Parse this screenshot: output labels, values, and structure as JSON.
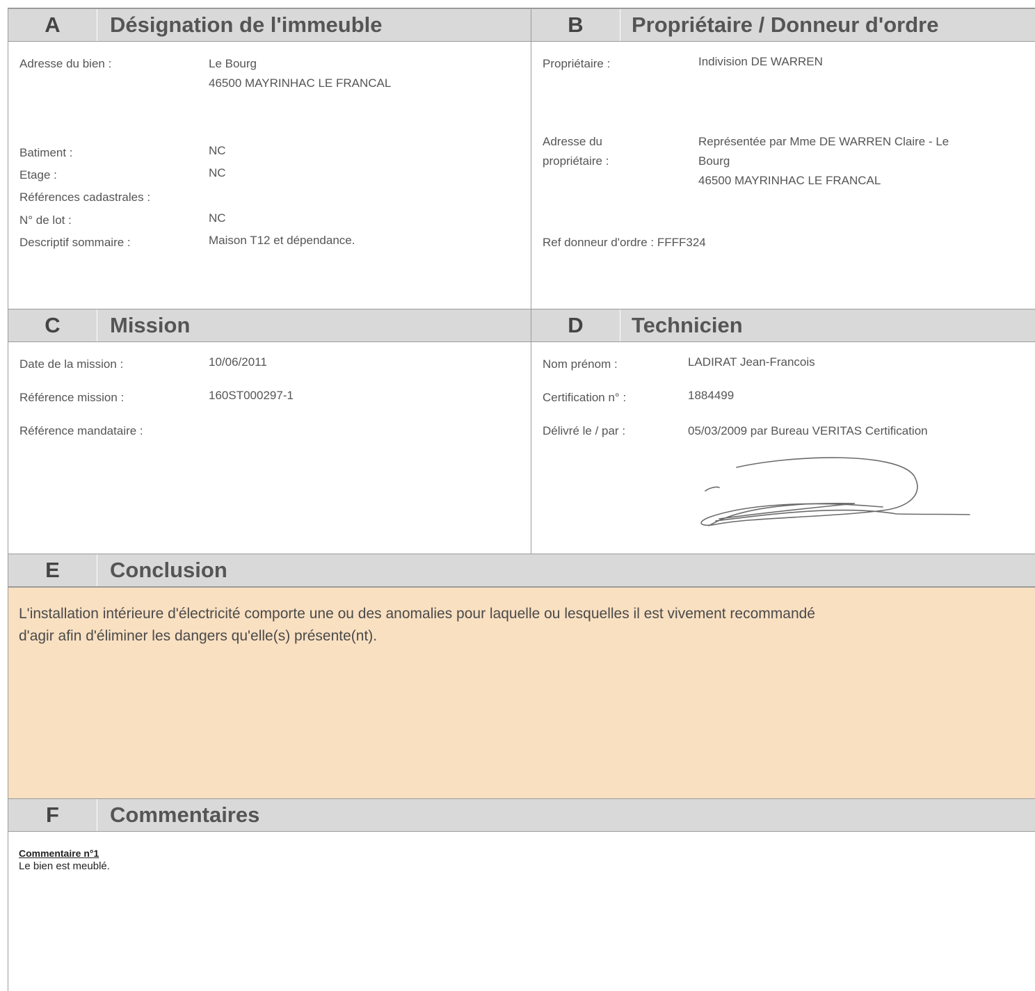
{
  "sections": {
    "a": {
      "letter": "A",
      "title": "Désignation de l'immeuble"
    },
    "b": {
      "letter": "B",
      "title": "Propriétaire / Donneur d'ordre"
    },
    "c": {
      "letter": "C",
      "title": "Mission"
    },
    "d": {
      "letter": "D",
      "title": "Technicien"
    },
    "e": {
      "letter": "E",
      "title": "Conclusion"
    },
    "f": {
      "letter": "F",
      "title": "Commentaires"
    }
  },
  "immeuble": {
    "adresse_label": "Adresse du bien :",
    "adresse_line1": "Le Bourg",
    "adresse_line2": "46500 MAYRINHAC LE FRANCAL",
    "batiment_label": "Batiment :",
    "batiment_value": "NC",
    "etage_label": "Etage :",
    "etage_value": "NC",
    "cadastre_label": "Références cadastrales :",
    "lot_label": "N° de lot :",
    "lot_value": "NC",
    "descriptif_label": "Descriptif sommaire :",
    "descriptif_value": "Maison T12 et dépendance."
  },
  "proprietaire": {
    "proprietaire_label": "Propriétaire :",
    "proprietaire_value": "Indivision DE WARREN",
    "adresse_label_line1": "Adresse du",
    "adresse_label_line2": "propriétaire :",
    "adresse_line1": "Représentée par Mme DE WARREN Claire - Le",
    "adresse_line2": "Bourg",
    "adresse_line3": "46500 MAYRINHAC LE FRANCAL",
    "ref_donneur": "Ref donneur d'ordre : FFFF324"
  },
  "mission": {
    "date_label": "Date de la mission :",
    "date_value": "10/06/2011",
    "ref_label": "Référence mission :",
    "ref_value": "160ST000297-1",
    "mandataire_label": "Référence mandataire :"
  },
  "technicien": {
    "nom_label": "Nom prénom :",
    "nom_value": "LADIRAT Jean-Francois",
    "certif_label": "Certification n° :",
    "certif_value": "1884499",
    "delivre_label": "Délivré le / par :",
    "delivre_value": "05/03/2009 par Bureau VERITAS Certification"
  },
  "conclusion": {
    "line1": "L'installation intérieure d'électricité comporte une ou des anomalies pour laquelle ou lesquelles il est vivement recommandé",
    "line2": "d'agir afin d'éliminer les dangers qu'elle(s) présente(nt)."
  },
  "commentaires": {
    "title": "Commentaire n°1",
    "body": "Le bien est meublé."
  },
  "colors": {
    "header_bg": "#d9d9d9",
    "conclusion_bg": "#f9e0c1",
    "border": "#9a9a9a"
  }
}
